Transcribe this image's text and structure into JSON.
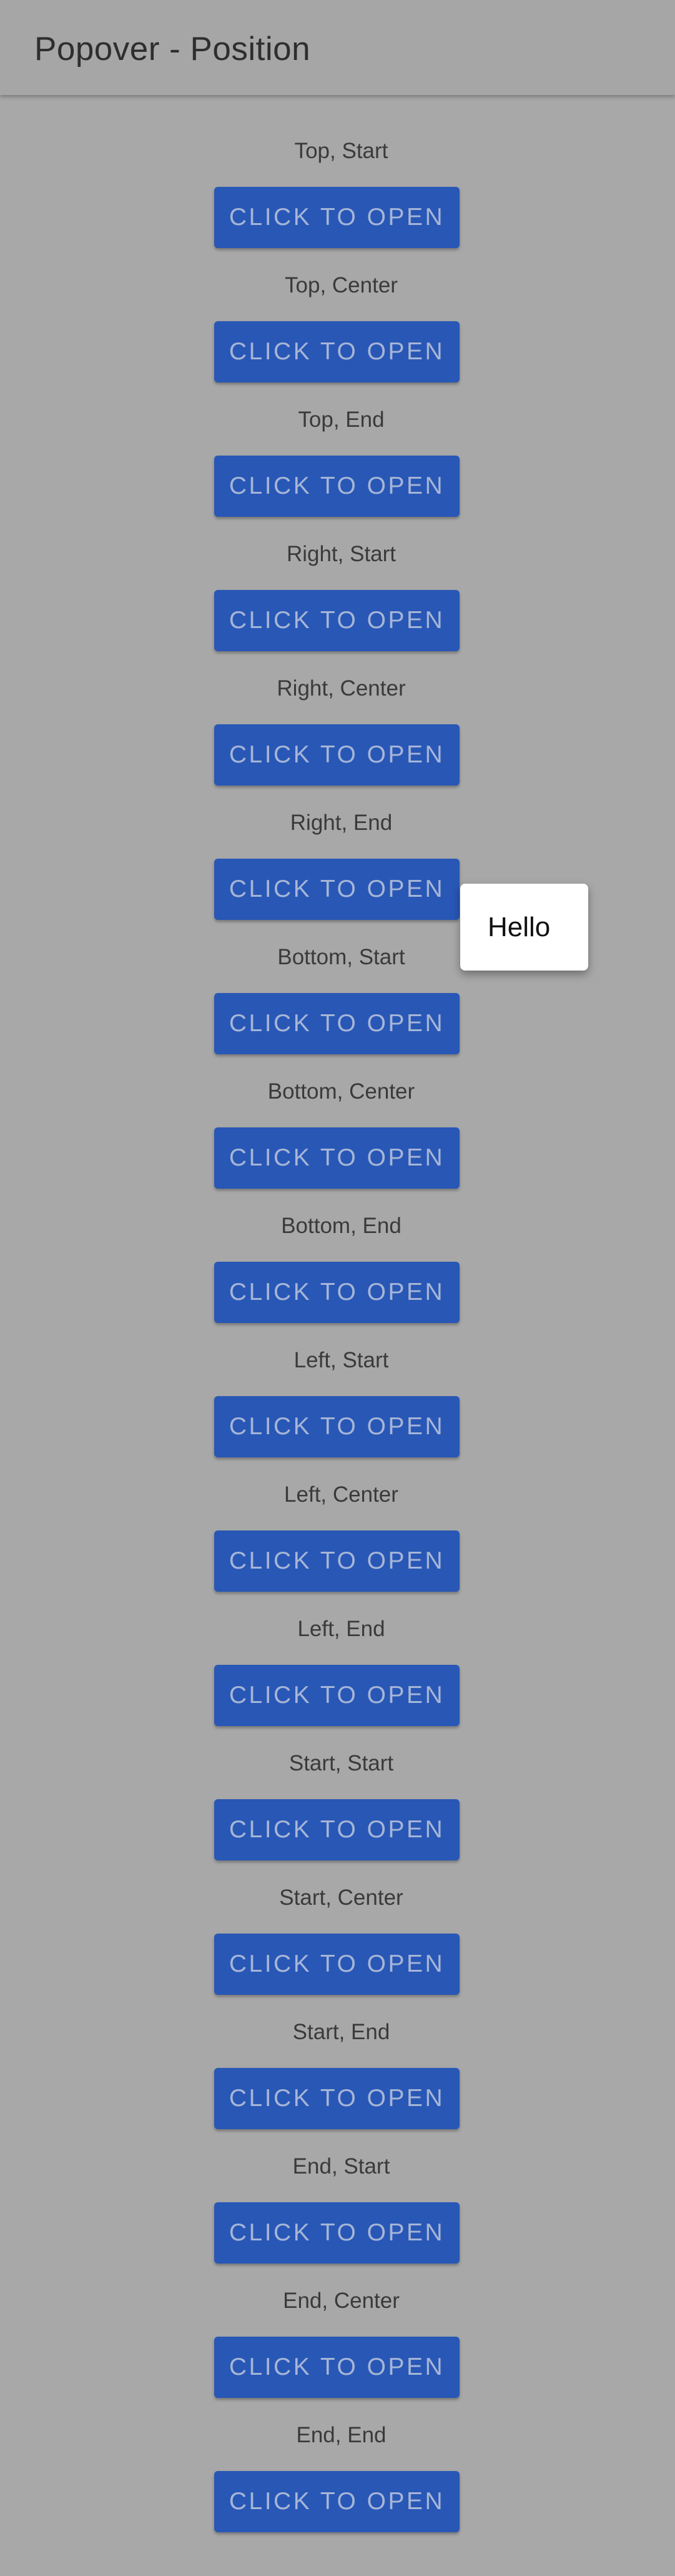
{
  "app_bar": {
    "title": "Popover - Position"
  },
  "button_label": "CLICK TO OPEN",
  "sections": [
    {
      "label": "Top, Start"
    },
    {
      "label": "Top, Center"
    },
    {
      "label": "Top, End"
    },
    {
      "label": "Right, Start"
    },
    {
      "label": "Right, Center"
    },
    {
      "label": "Right, End"
    },
    {
      "label": "Bottom, Start"
    },
    {
      "label": "Bottom, Center"
    },
    {
      "label": "Bottom, End"
    },
    {
      "label": "Left, Start"
    },
    {
      "label": "Left, Center"
    },
    {
      "label": "Left, End"
    },
    {
      "label": "Start, Start"
    },
    {
      "label": "Start, Center"
    },
    {
      "label": "Start, End"
    },
    {
      "label": "End, Start"
    },
    {
      "label": "End, Center"
    },
    {
      "label": "End, End"
    }
  ],
  "popover": {
    "text": "Hello"
  },
  "colors": {
    "page_background": "#a8a8a8",
    "button": "#2857b6",
    "button_text": "#a6b5d6",
    "popover_background": "#ffffff"
  }
}
